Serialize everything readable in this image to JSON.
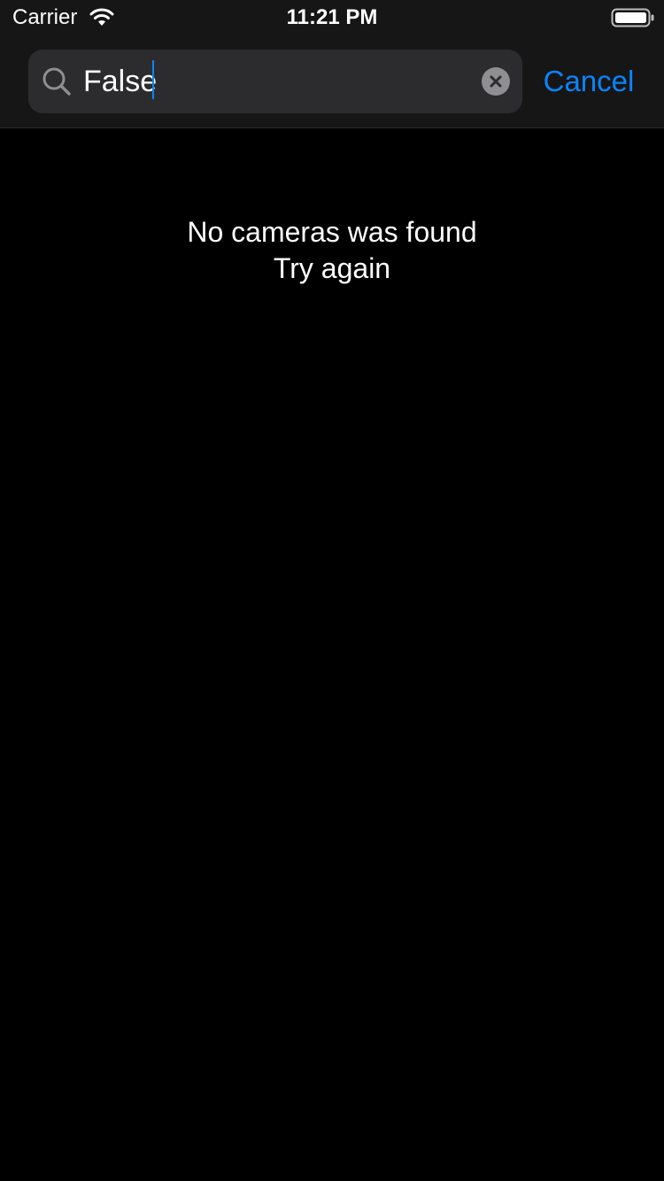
{
  "status_bar": {
    "carrier": "Carrier",
    "time": "11:21 PM",
    "wifi_icon": "wifi-icon",
    "battery_icon": "battery-icon"
  },
  "search": {
    "value": "False",
    "search_icon": "search-icon",
    "clear_icon": "clear-icon",
    "cancel_label": "Cancel"
  },
  "empty_state": {
    "message": "No cameras was found",
    "action": "Try again"
  },
  "colors": {
    "accent": "#0a84ff",
    "background": "#000000",
    "search_field": "#2c2c2e",
    "text": "#ffffff"
  }
}
